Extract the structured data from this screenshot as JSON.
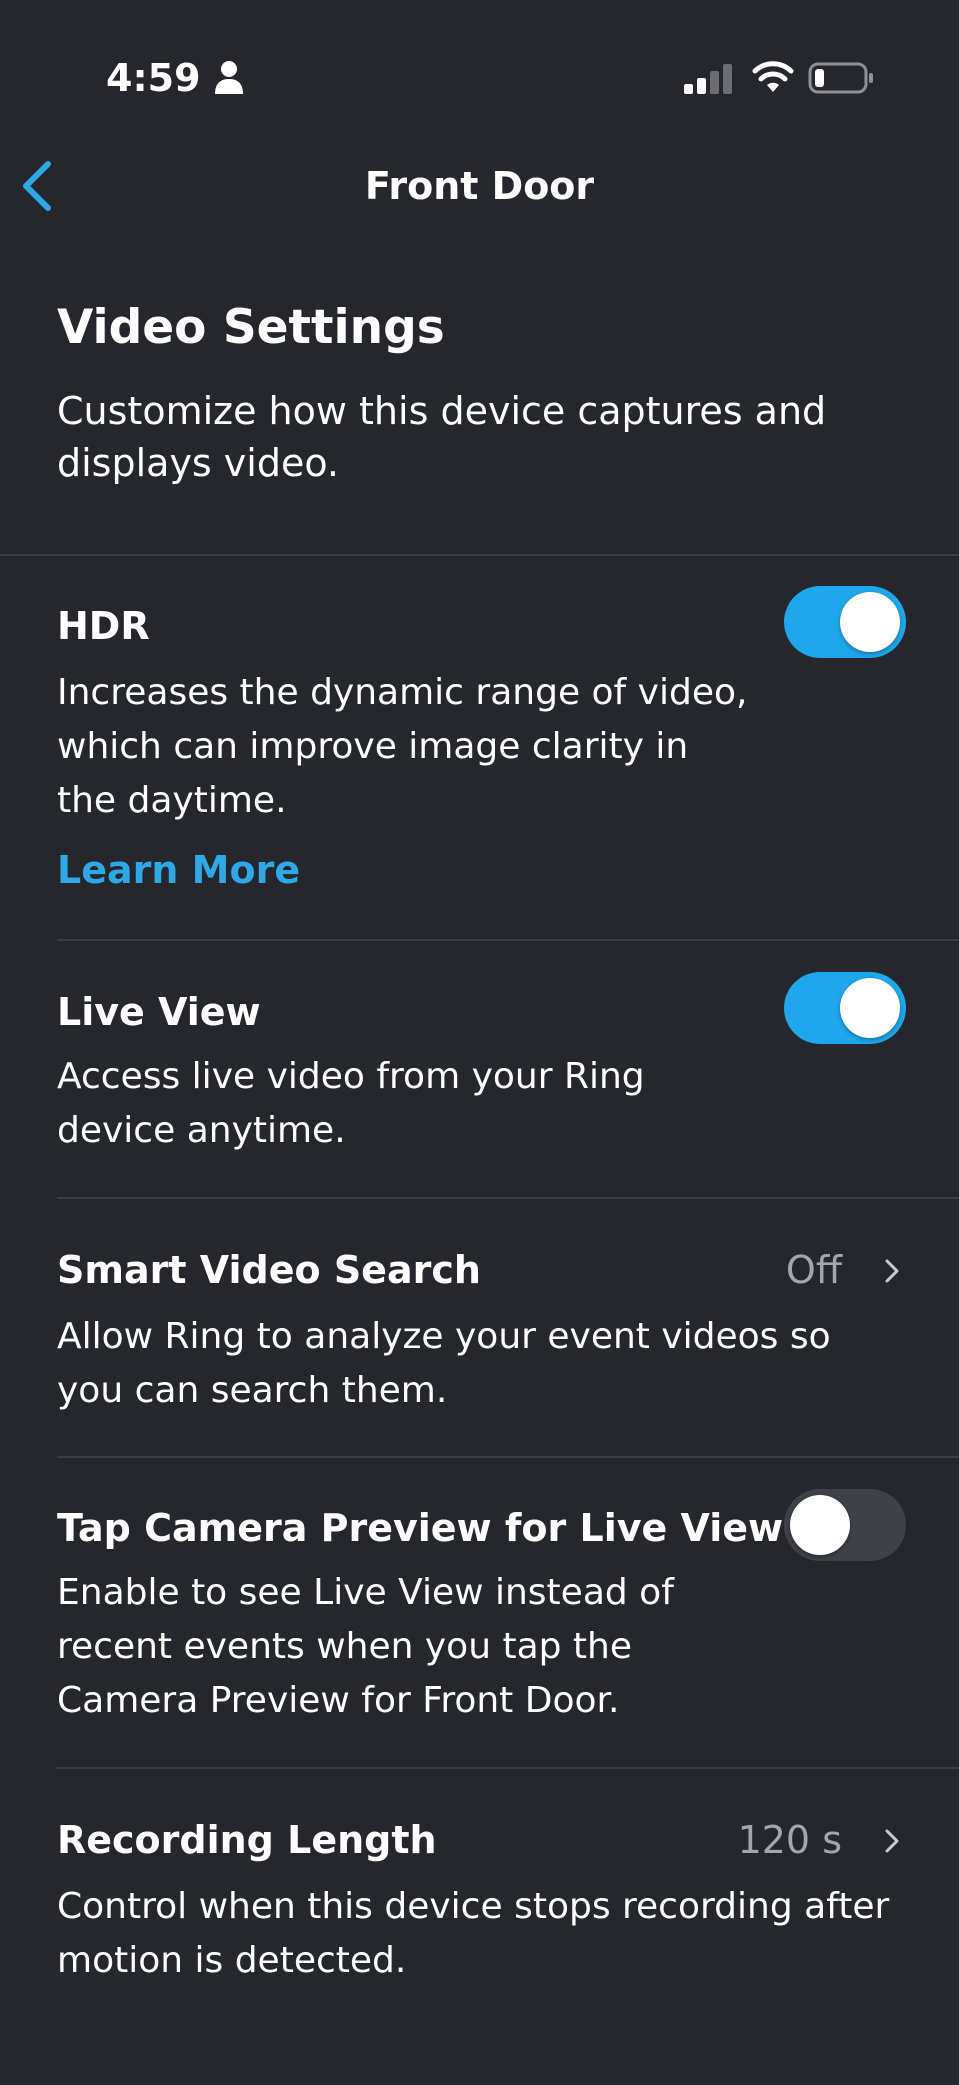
{
  "status_bar": {
    "time": "4:59",
    "icons": [
      "person-icon",
      "signal-icon",
      "wifi-icon",
      "battery-icon"
    ]
  },
  "nav": {
    "title": "Front Door",
    "back_icon": "chevron-left-icon"
  },
  "header": {
    "title": "Video Settings",
    "description": "Customize how this device captures and displays video."
  },
  "settings": {
    "hdr": {
      "title": "HDR",
      "description": "Increases the dynamic range of video, which can improve image clarity in the daytime.",
      "link": "Learn More",
      "enabled": true
    },
    "live_view": {
      "title": "Live View",
      "description": "Access live video from your Ring device anytime.",
      "enabled": true
    },
    "smart_video_search": {
      "title": "Smart Video Search",
      "value": "Off",
      "description": "Allow Ring to analyze your event videos so you can search them."
    },
    "tap_camera_preview": {
      "title": "Tap Camera Preview for Live View",
      "description": "Enable to see Live View instead of recent events when you tap the Camera Preview for Front Door.",
      "enabled": false
    },
    "recording_length": {
      "title": "Recording Length",
      "value": "120 s",
      "description": "Control when this device stops recording after motion is detected."
    }
  },
  "colors": {
    "background": "#25272c",
    "accent": "#1ea7ec",
    "link": "#2ea8e6",
    "secondary_text": "#a3a6ab",
    "divider": "#3a3d43"
  }
}
